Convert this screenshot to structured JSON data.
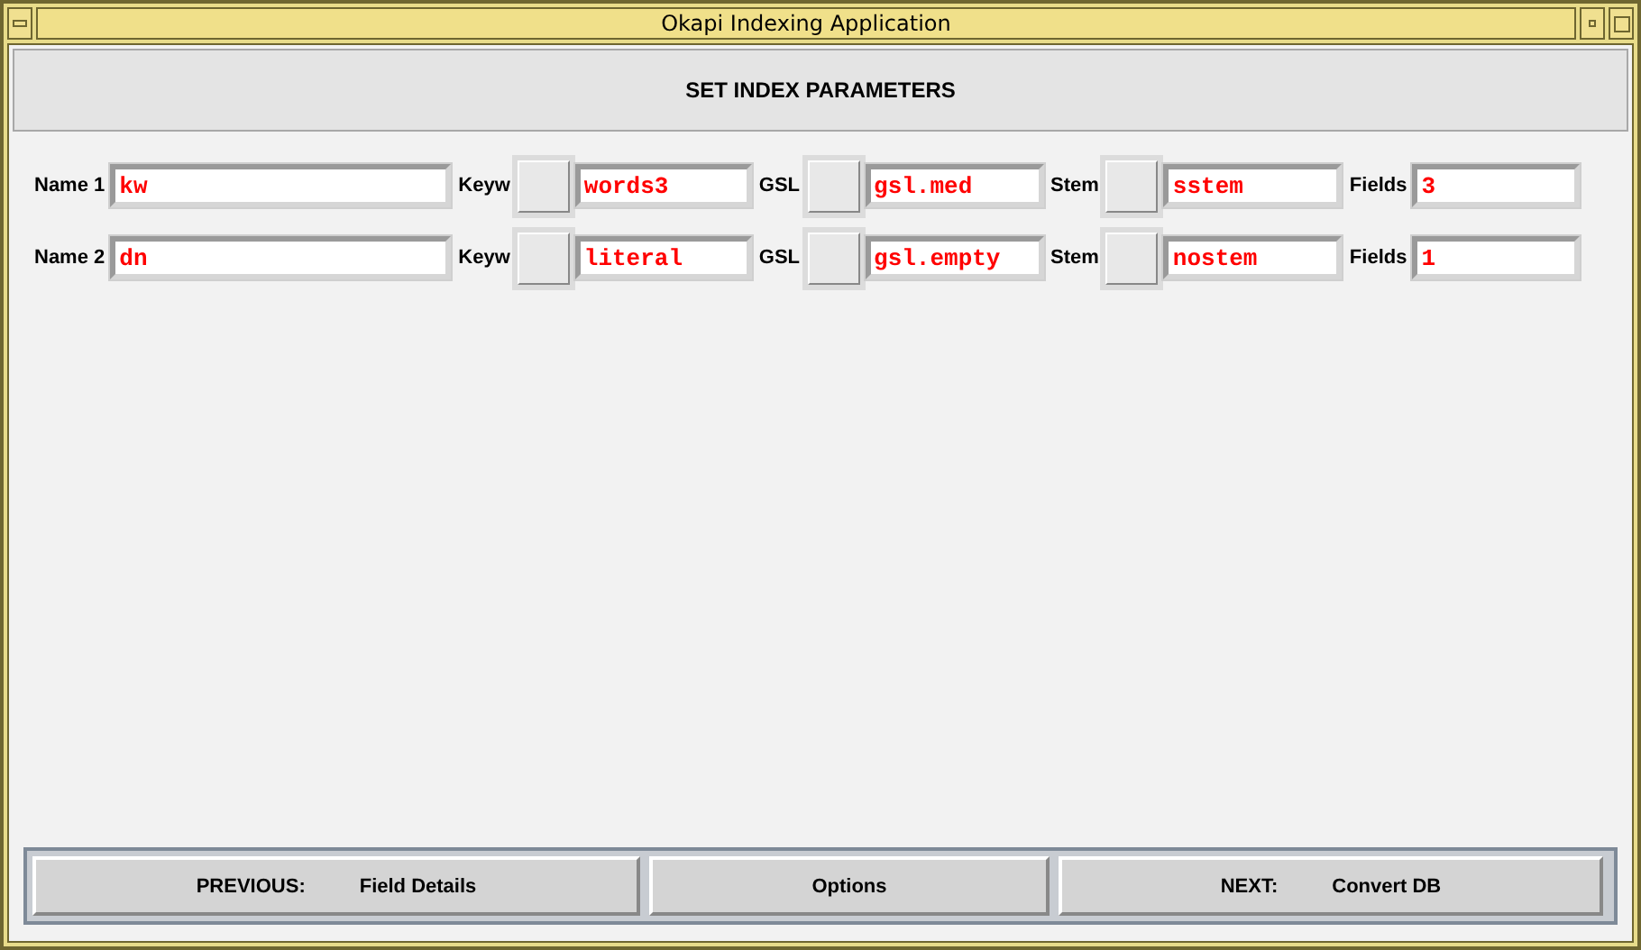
{
  "window": {
    "title": "Okapi Indexing Application"
  },
  "header": "SET INDEX PARAMETERS",
  "rows": [
    {
      "name_label": "Name 1",
      "name": "kw",
      "keyw_label": "Keyw",
      "keyw": "words3",
      "gsl_label": "GSL",
      "gsl": "gsl.med",
      "stem_label": "Stem",
      "stem": "sstem",
      "fields_label": "Fields",
      "fields": "3"
    },
    {
      "name_label": "Name 2",
      "name": "dn",
      "keyw_label": "Keyw",
      "keyw": "literal",
      "gsl_label": "GSL",
      "gsl": "gsl.empty",
      "stem_label": "Stem",
      "stem": "nostem",
      "fields_label": "Fields",
      "fields": "1"
    }
  ],
  "nav": [
    {
      "prefix": "PREVIOUS:",
      "label": "Field Details"
    },
    {
      "label": "Options"
    },
    {
      "prefix": "NEXT:",
      "label": "Convert DB"
    }
  ]
}
